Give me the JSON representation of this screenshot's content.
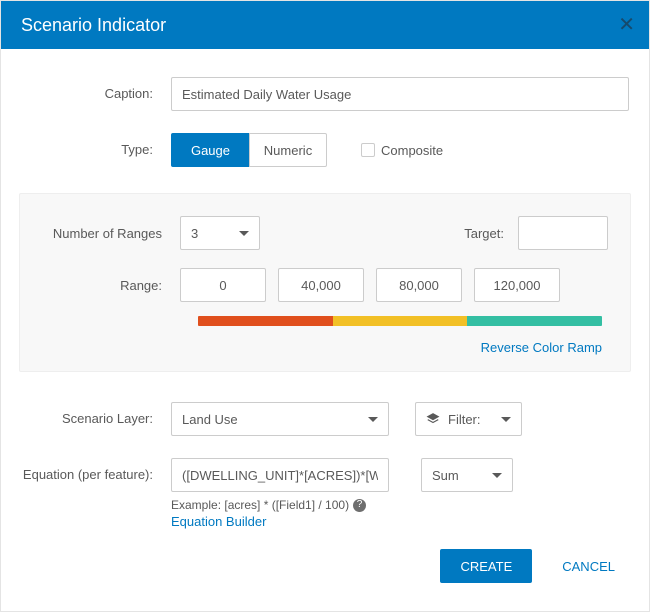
{
  "header": {
    "title": "Scenario Indicator"
  },
  "caption": {
    "label": "Caption:",
    "value": "Estimated Daily Water Usage"
  },
  "type": {
    "label": "Type:",
    "options": {
      "gauge": "Gauge",
      "numeric": "Numeric"
    },
    "composite_label": "Composite"
  },
  "ranges": {
    "num_label": "Number of Ranges",
    "num_value": "3",
    "target_label": "Target:",
    "target_value": "",
    "range_label": "Range:",
    "stops": [
      "0",
      "40,000",
      "80,000",
      "120,000"
    ],
    "colors": [
      "#e04f1d",
      "#f2c026",
      "#34bfa3"
    ],
    "reverse_label": "Reverse Color Ramp"
  },
  "scenario_layer": {
    "label": "Scenario Layer:",
    "value": "Land Use",
    "filter_label": "Filter:"
  },
  "equation": {
    "label": "Equation (per feature):",
    "value": "([DWELLING_UNIT]*[ACRES])*[WATE",
    "example_prefix": "Example: [acres] * ([Field1] / 100)",
    "builder_label": "Equation Builder",
    "agg_value": "Sum"
  },
  "footer": {
    "create": "CREATE",
    "cancel": "CANCEL"
  }
}
